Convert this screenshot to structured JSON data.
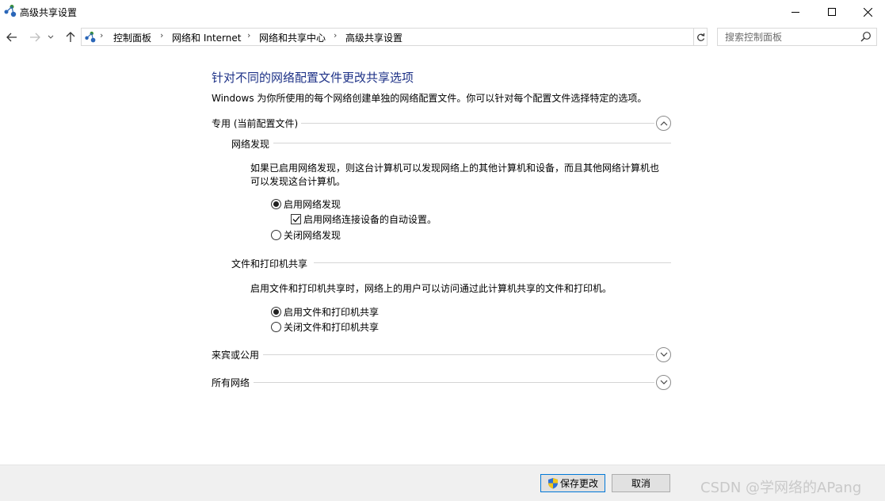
{
  "window": {
    "title": "高级共享设置"
  },
  "address": {
    "crumbs": [
      "控制面板",
      "网络和 Internet",
      "网络和共享中心",
      "高级共享设置"
    ]
  },
  "search": {
    "placeholder": "搜索控制面板"
  },
  "main": {
    "heading": "针对不同的网络配置文件更改共享选项",
    "description": "Windows 为你所使用的每个网络创建单独的网络配置文件。你可以针对每个配置文件选择特定的选项。",
    "sections": [
      {
        "label": "专用 (当前配置文件)",
        "expanded": true
      },
      {
        "label": "来宾或公用",
        "expanded": false
      },
      {
        "label": "所有网络",
        "expanded": false
      }
    ],
    "network_discovery": {
      "title": "网络发现",
      "para_line1": "如果已启用网络发现，则这台计算机可以发现网络上的其他计算机和设备，而且其他网络计算机也",
      "para_line2": "可以发现这台计算机。",
      "on_label": "启用网络发现",
      "auto_setup_label": "启用网络连接设备的自动设置。",
      "off_label": "关闭网络发现",
      "selected": "on",
      "auto_setup_checked": true
    },
    "file_sharing": {
      "title": "文件和打印机共享",
      "para": "启用文件和打印机共享时，网络上的用户可以访问通过此计算机共享的文件和打印机。",
      "on_label": "启用文件和打印机共享",
      "off_label": "关闭文件和打印机共享",
      "selected": "on"
    }
  },
  "footer": {
    "save_label": "保存更改",
    "cancel_label": "取消",
    "watermark": "CSDN @学网络的APang"
  },
  "colors": {
    "heading": "#1e3287",
    "accent": "#0078d7",
    "shield_blue": "#2d6fd6",
    "shield_yellow": "#f2c618"
  }
}
